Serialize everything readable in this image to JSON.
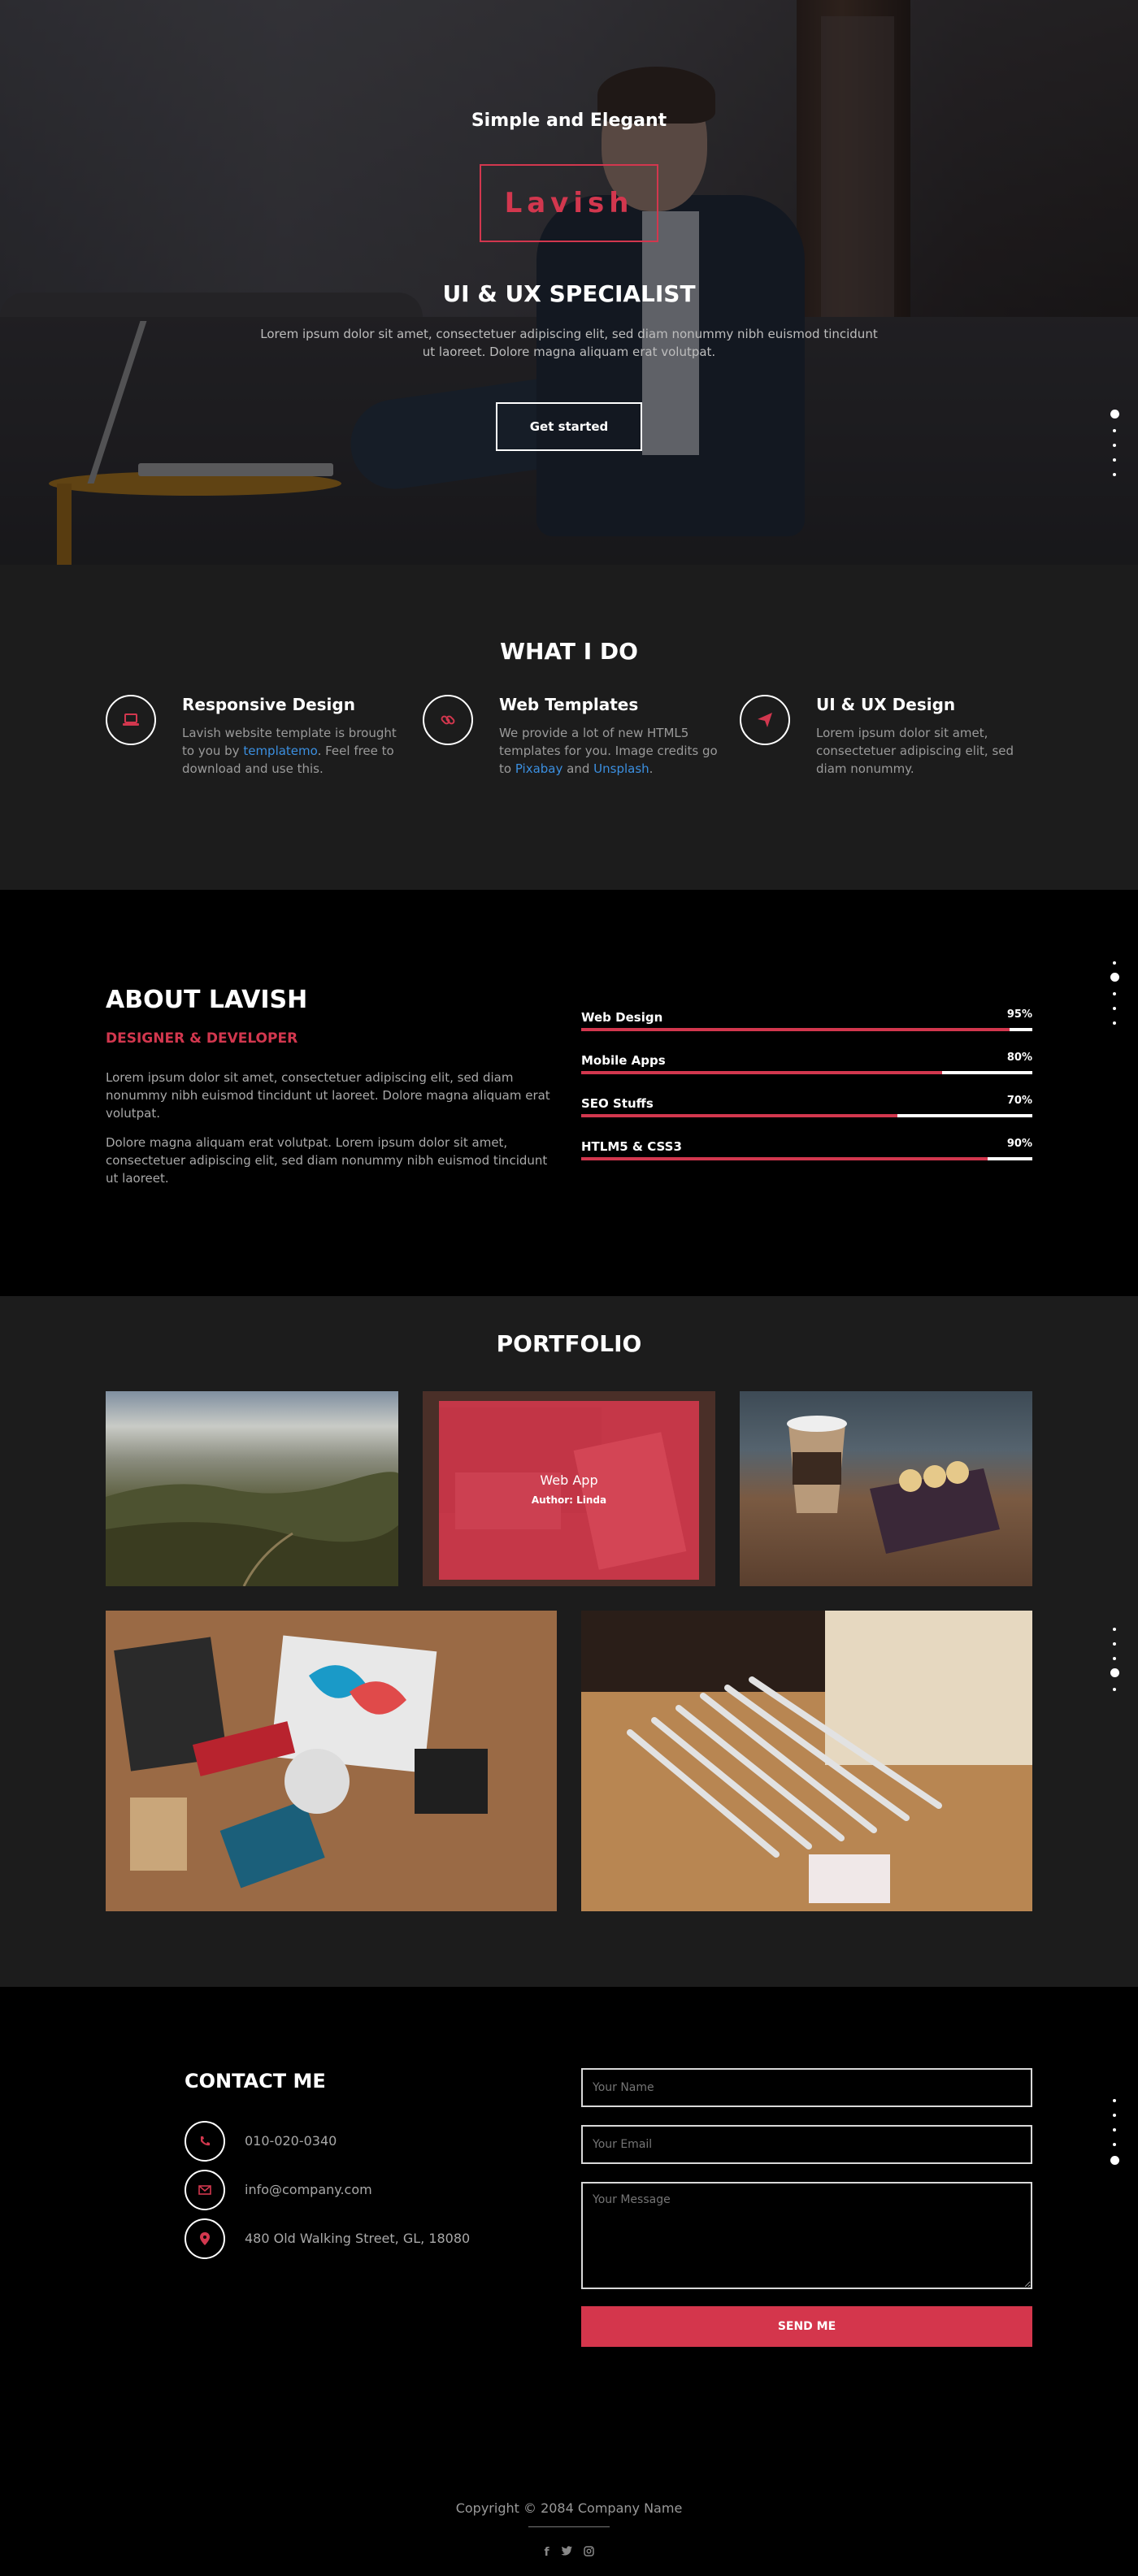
{
  "hero": {
    "kicker": "Simple and Elegant",
    "logo": "Lavish",
    "title": "UI & UX SPECIALIST",
    "subtitle": "Lorem ipsum dolor sit amet, consectetuer adipiscing elit, sed diam nonummy nibh euismod tincidunt ut laoreet. Dolore magna aliquam erat volutpat.",
    "cta": "Get started"
  },
  "what_i_do": {
    "title": "WHAT I DO",
    "services": [
      {
        "icon": "laptop-icon",
        "title": "Responsive Design",
        "text_before": "Lavish website template is brought to you by ",
        "link": "templatemo",
        "text_after": ". Feel free to download and use this."
      },
      {
        "icon": "link-icon",
        "title": "Web Templates",
        "text_before": "We provide a lot of new HTML5 templates for you. Image credits go to ",
        "link": "Pixabay",
        "text_mid": " and ",
        "link2": "Unsplash",
        "text_after": "."
      },
      {
        "icon": "paper-plane-icon",
        "title": "UI & UX Design",
        "text": "Lorem ipsum dolor sit amet, consectetuer adipiscing elit, sed diam nonummy."
      }
    ]
  },
  "about": {
    "title": "ABOUT LAVISH",
    "role": "DESIGNER & DEVELOPER",
    "p1": "Lorem ipsum dolor sit amet, consectetuer adipiscing elit, sed diam nonummy nibh euismod tincidunt ut laoreet. Dolore magna aliquam erat volutpat.",
    "p2": "Dolore magna aliquam erat volutpat. Lorem ipsum dolor sit amet, consectetuer adipiscing elit, sed diam nonummy nibh euismod tincidunt ut laoreet.",
    "skills": [
      {
        "name": "Web Design",
        "pct_label": "95%",
        "value": 95
      },
      {
        "name": "Mobile Apps",
        "pct_label": "80%",
        "value": 80
      },
      {
        "name": "SEO Stuffs",
        "pct_label": "70%",
        "value": 70
      },
      {
        "name": "HTLM5 & CSS3",
        "pct_label": "90%",
        "value": 90
      }
    ]
  },
  "portfolio": {
    "title": "PORTFOLIO",
    "hover_caption": {
      "title": "Web App",
      "author": "Author: Linda"
    }
  },
  "contact": {
    "title": "CONTACT ME",
    "phone": "010-020-0340",
    "email": "info@company.com",
    "address": "480 Old Walking Street, GL, 18080",
    "name_placeholder": "Your Name",
    "email_placeholder": "Your Email",
    "message_placeholder": "Your Message",
    "send": "SEND ME"
  },
  "footer": {
    "copyright": "Copyright © 2084 Company Name",
    "social": [
      "f",
      "twitter-icon",
      "instagram-icon"
    ]
  },
  "colors": {
    "accent": "#d2374e",
    "link": "#3b8fe0",
    "dark_section": "#1c1c1c",
    "black_section": "#000000"
  }
}
